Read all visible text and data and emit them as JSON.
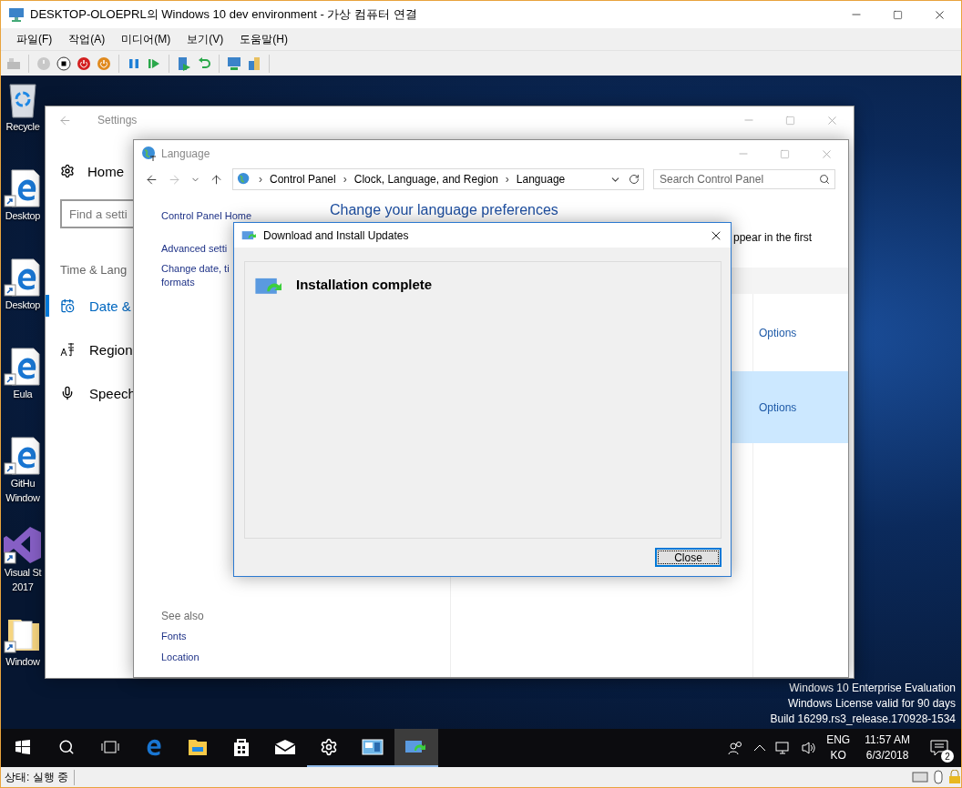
{
  "vm_window": {
    "title": "DESKTOP-OLOEPRL의 Windows 10 dev environment - 가상 컴퓨터 연결",
    "menu": [
      "파일(F)",
      "작업(A)",
      "미디어(M)",
      "보기(V)",
      "도움말(H)"
    ],
    "status": "상태: 실행 중"
  },
  "desktop": {
    "icons": [
      {
        "kind": "recycle",
        "lines": [
          "Recycle"
        ]
      },
      {
        "kind": "edge",
        "lines": [
          "Desktop"
        ]
      },
      {
        "kind": "edge",
        "lines": [
          "Desktop"
        ]
      },
      {
        "kind": "edge",
        "lines": [
          "Eula"
        ]
      },
      {
        "kind": "edge",
        "lines": [
          "GitHu",
          "Window"
        ]
      },
      {
        "kind": "vs",
        "lines": [
          "Visual St",
          "2017"
        ]
      },
      {
        "kind": "folder",
        "lines": [
          "Window"
        ]
      }
    ],
    "watermark": [
      "Windows 10 Enterprise Evaluation",
      "Windows License valid for 90 days",
      "Build 16299.rs3_release.170928-1534"
    ]
  },
  "settings": {
    "title": "Settings",
    "home": "Home",
    "search_placeholder": "Find a setti",
    "section": "Time & Lang",
    "nav": [
      {
        "kind": "calendar",
        "label": "Date & ",
        "selected": true
      },
      {
        "kind": "region",
        "label": "Region",
        "selected": false
      },
      {
        "kind": "mic",
        "label": "Speech",
        "selected": false
      }
    ]
  },
  "language_window": {
    "title": "Language",
    "breadcrumb": [
      {
        "separator": "›",
        "label": "Control Panel"
      },
      {
        "separator": "›",
        "label": "Clock, Language, and Region"
      },
      {
        "separator": "›",
        "label": "Language"
      }
    ],
    "search_placeholder": "Search Control Panel",
    "sidebar_links": [
      {
        "lines": [
          "Control Panel Home"
        ]
      },
      {
        "lines": [
          "Advanced setti"
        ]
      },
      {
        "lines": [
          "Change date, ti",
          "formats"
        ]
      }
    ],
    "heading": "Change your language preferences",
    "description": "ppear in the first",
    "rows": [
      {
        "action": "Options",
        "selected": false
      },
      {
        "action": "Options",
        "selected": true
      }
    ],
    "see_also": {
      "label": "See also",
      "links": [
        "Fonts",
        "Location"
      ]
    }
  },
  "dialog": {
    "title": "Download and Install Updates",
    "message": "Installation complete",
    "button": "Close"
  },
  "taskbar": {
    "apps": [
      {
        "kind": "edge",
        "running": false,
        "active": false
      },
      {
        "kind": "explorer",
        "running": false,
        "active": false
      },
      {
        "kind": "store",
        "running": false,
        "active": false
      },
      {
        "kind": "mail",
        "running": false,
        "active": false
      },
      {
        "kind": "settings",
        "running": true,
        "active": false
      },
      {
        "kind": "control-panel",
        "running": true,
        "active": false
      },
      {
        "kind": "updates",
        "running": true,
        "active": true
      }
    ],
    "language": [
      "ENG",
      "KO"
    ],
    "time": "11:57 AM",
    "date": "6/3/2018",
    "notifications": "2"
  }
}
